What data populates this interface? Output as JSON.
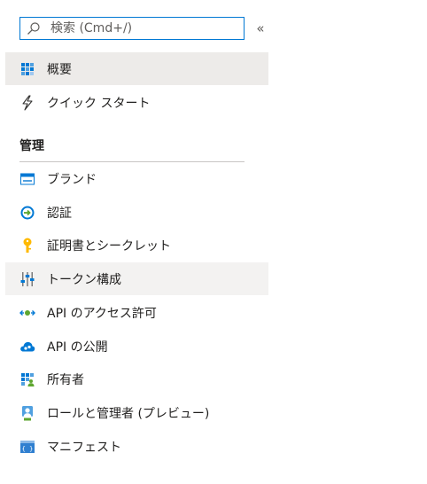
{
  "search": {
    "placeholder": "検索 (Cmd+/)",
    "collapse_label": "«"
  },
  "top_items": [
    {
      "label": "概要",
      "icon": "overview-grid-icon"
    },
    {
      "label": "クイック スタート",
      "icon": "lightning-icon"
    }
  ],
  "manage_section": {
    "header": "管理",
    "items": [
      {
        "label": "ブランド",
        "icon": "branding-icon"
      },
      {
        "label": "認証",
        "icon": "authentication-icon"
      },
      {
        "label": "証明書とシークレット",
        "icon": "key-icon"
      },
      {
        "label": "トークン構成",
        "icon": "token-config-icon"
      },
      {
        "label": "API のアクセス許可",
        "icon": "api-permissions-icon"
      },
      {
        "label": "API の公開",
        "icon": "expose-api-cloud-icon"
      },
      {
        "label": "所有者",
        "icon": "owners-icon"
      },
      {
        "label": "ロールと管理者 (プレビュー)",
        "icon": "roles-admins-icon"
      },
      {
        "label": "マニフェスト",
        "icon": "manifest-icon"
      }
    ]
  },
  "colors": {
    "accent": "#0078d4",
    "selected_bg": "#edebe9",
    "hover_bg": "#f3f2f1"
  }
}
